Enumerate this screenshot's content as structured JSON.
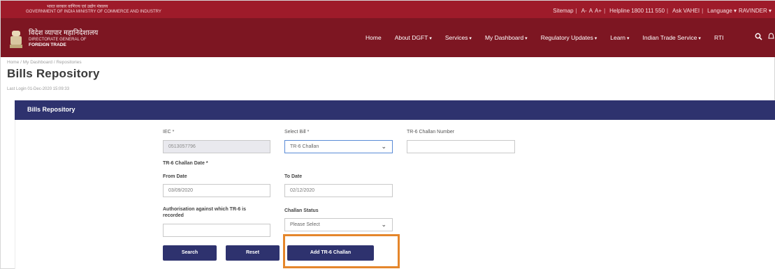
{
  "top_strip": {
    "gov_line1": "भारत सरकार   वाणिज्य एवं उद्योग मंत्रालय",
    "gov_line2": "GOVERNMENT OF INDIA   MINISTRY OF COMMERCE AND INDUSTRY",
    "utility_links": [
      "Sitemap",
      "|",
      "A-",
      "A",
      "A+",
      "|",
      "Helpline 1800 111 550",
      "|",
      "Ask VAHEI",
      "|",
      "Language ▾",
      "RAVINDER ▾"
    ]
  },
  "org": {
    "hindi": "विदेश व्यापार महानिदेशालय",
    "line1": "DIRECTORATE GENERAL OF",
    "line2": "FOREIGN TRADE"
  },
  "menu": [
    {
      "label": "Home",
      "caret": false
    },
    {
      "label": "About DGFT",
      "caret": true
    },
    {
      "label": "Services",
      "caret": true
    },
    {
      "label": "My Dashboard",
      "caret": true
    },
    {
      "label": "Regulatory Updates",
      "caret": true
    },
    {
      "label": "Learn",
      "caret": true
    },
    {
      "label": "Indian Trade Service",
      "caret": true
    },
    {
      "label": "RTI",
      "caret": false
    }
  ],
  "icons": {
    "search": "search-icon",
    "bell": "bell-icon"
  },
  "breadcrumb": "Home / My Dashboard / Repositories",
  "page_title": "Bills Repository",
  "last_login": "Last Login 01-Dec-2020 15:09:33",
  "card": {
    "title": "Bills Repository",
    "iec_label": "IEC *",
    "iec_value": "0513057796",
    "select_bill_label": "Select Bill *",
    "select_bill_value": "TR-6 Challan",
    "tr6_number_label": "TR-6 Challan Number",
    "tr6_number_value": "",
    "tr6_date_label": "TR-6 Challan Date *",
    "from_date_label": "From Date",
    "from_date_value": "03/09/2020",
    "to_date_label": "To Date",
    "to_date_value": "02/12/2020",
    "auth_label_line1": "Authorisation against which TR-6 is",
    "auth_label_line2": "recorded",
    "auth_value": "",
    "challan_status_label": "Challan Status",
    "challan_status_value": "Please Select",
    "search_button": "Search",
    "reset_button": "Reset",
    "add_button": "Add TR-6 Challan"
  },
  "colors": {
    "top_strip": "#9e1b2a",
    "nav_bar": "#7d1622",
    "card_header": "#2e326e",
    "button": "#2e326e",
    "highlight_frame": "#e5862b"
  }
}
